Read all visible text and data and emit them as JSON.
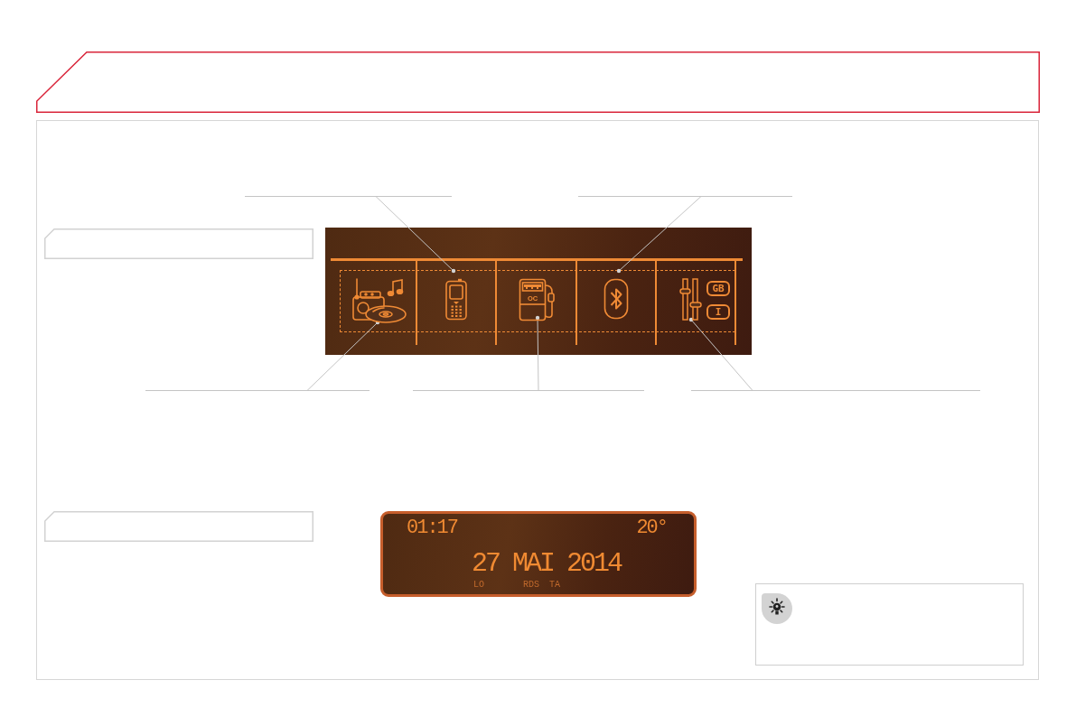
{
  "menu_display": {
    "items": [
      {
        "kind": "audio"
      },
      {
        "kind": "phone"
      },
      {
        "kind": "fuel",
        "label": "OC"
      },
      {
        "kind": "bluetooth"
      },
      {
        "kind": "settings",
        "tags": [
          "GB",
          "I"
        ]
      }
    ]
  },
  "clock_display": {
    "time": "01:17",
    "temperature": "20°",
    "date": "27 MAI 2014",
    "indicators": [
      "LO",
      "RDS",
      "TA"
    ]
  }
}
